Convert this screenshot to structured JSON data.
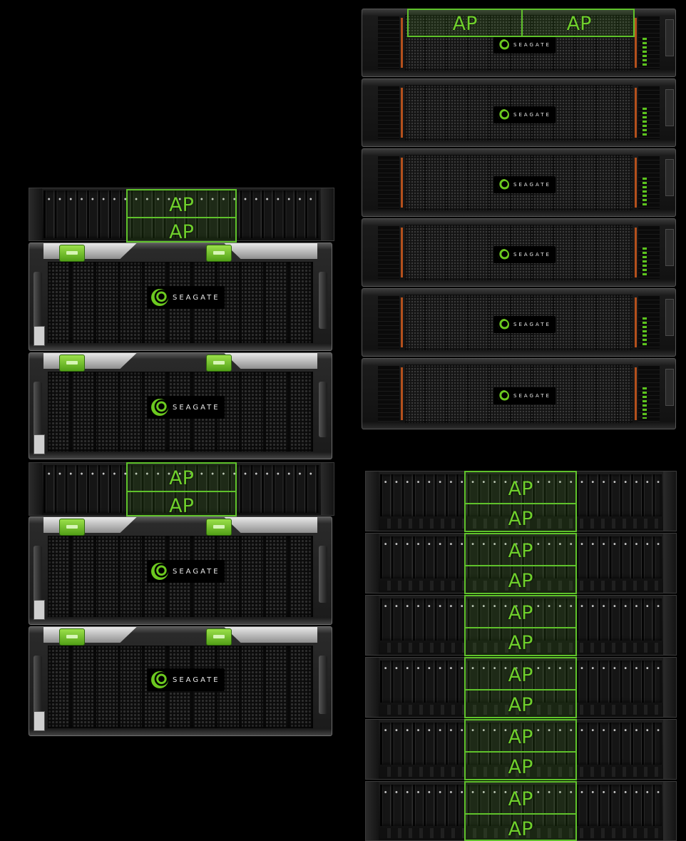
{
  "labels": {
    "ap": "AP"
  },
  "logo": {
    "brand": "SEAGATE"
  },
  "colors": {
    "background": "#000000",
    "ap_green": "#5fc22b",
    "latch_green": "#7ed03a",
    "stripe_orange": "#b4501c"
  }
}
